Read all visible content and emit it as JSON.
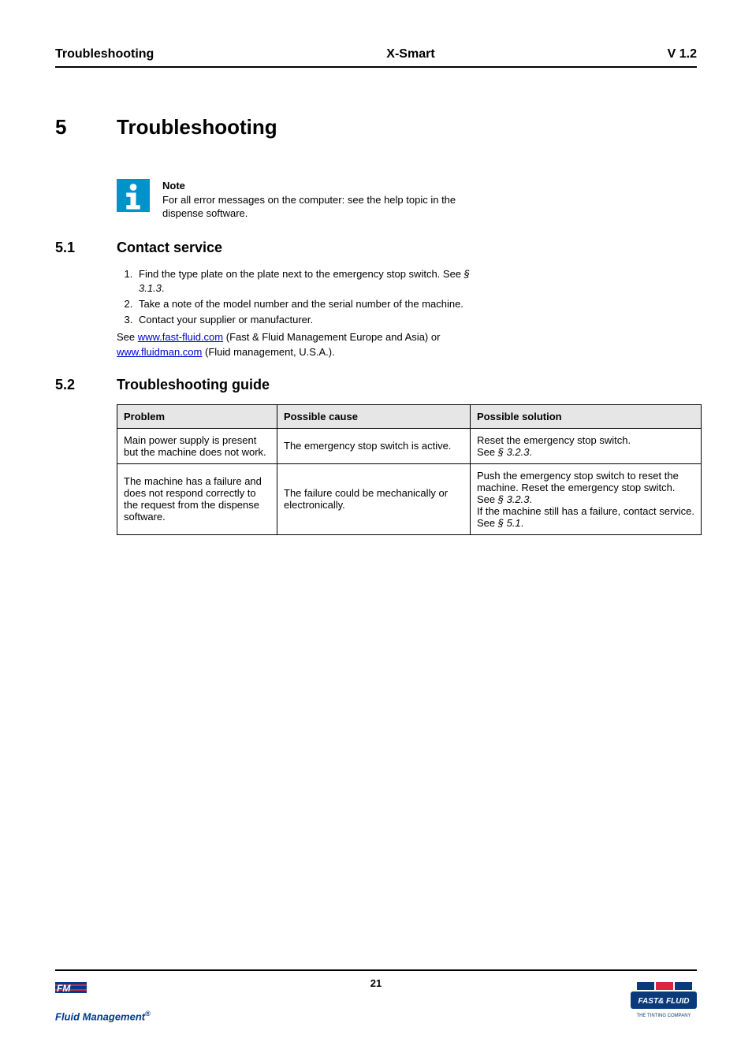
{
  "header": {
    "left": "Troubleshooting",
    "center": "X-Smart",
    "right": "V 1.2"
  },
  "chapter": {
    "num": "5",
    "title": "Troubleshooting"
  },
  "note": {
    "label": "Note",
    "body": "For all error messages on the computer: see the help topic in the dispense software."
  },
  "sections": {
    "contact": {
      "num": "5.1",
      "title": "Contact service",
      "steps": [
        {
          "pre": "Find the type plate on the plate next to the emergency stop switch. See ",
          "ref": "§ 3.1.3",
          "post": "."
        },
        {
          "pre": "Take a note of the model number and the serial number of the machine.",
          "ref": "",
          "post": ""
        },
        {
          "pre": "Contact your supplier or manufacturer.",
          "ref": "",
          "post": ""
        }
      ],
      "tail_pre": "See ",
      "link1_text": "www.fast-fluid.com",
      "tail_mid1": " (Fast & Fluid Management Europe and Asia) or ",
      "link2_text": "www.fluidman.com",
      "tail_mid2": " (Fluid management, U.S.A.)."
    },
    "guide": {
      "num": "5.2",
      "title": "Troubleshooting guide",
      "headers": [
        "Problem",
        "Possible cause",
        "Possible solution"
      ],
      "rows": [
        {
          "problem": "Main power supply is present but the machine does not work.",
          "cause": "The emergency stop switch is active.",
          "sol_pre": "Reset the emergency stop switch.\nSee ",
          "sol_ref": "§ 3.2.3",
          "sol_post": "."
        },
        {
          "problem": "The machine has a failure and does not respond correctly to the request from the dispense software.",
          "cause": "The failure could be mechanically or electronically.",
          "sol_pre": "Push the emergency stop switch to reset the machine. Reset the emergency stop switch. See ",
          "sol_ref": "§ 3.2.3",
          "sol_mid": ".\nIf the machine still has a failure, contact service. See ",
          "sol_ref2": "§ 5.1",
          "sol_post": "."
        }
      ]
    }
  },
  "footer": {
    "page": "21",
    "left_brand": "Fluid Management",
    "right_brand_top": "FAST& FLUID",
    "right_brand_sub": "THE TINTING COMPANY"
  }
}
